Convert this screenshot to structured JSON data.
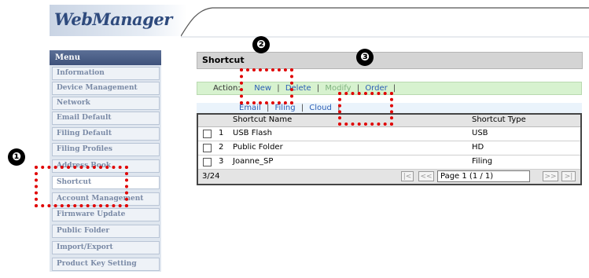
{
  "app": {
    "logo_text": "WebManager"
  },
  "sidebar": {
    "header": "Menu",
    "items": [
      {
        "label": "Information"
      },
      {
        "label": "Device Management"
      },
      {
        "label": "Network"
      },
      {
        "label": "Email Default"
      },
      {
        "label": "Filing Default"
      },
      {
        "label": "Filing Profiles"
      },
      {
        "label": "Address Book"
      },
      {
        "label": "Shortcut",
        "active": true
      },
      {
        "label": "Account Management"
      },
      {
        "label": "Firmware Update"
      },
      {
        "label": "Public Folder"
      },
      {
        "label": "Import/Export"
      },
      {
        "label": "Product Key Setting"
      }
    ]
  },
  "main": {
    "title": "Shortcut",
    "action_label": "Action:",
    "actions": [
      "New",
      "Delete",
      "Modify",
      "Order"
    ],
    "sub_tabs": [
      "Email",
      "Filing",
      "Cloud"
    ],
    "table": {
      "headers": {
        "name": "Shortcut Name",
        "type": "Shortcut Type"
      },
      "rows": [
        {
          "num": "1",
          "name": "USB Flash",
          "type": "USB"
        },
        {
          "num": "2",
          "name": "Public Folder",
          "type": "HD"
        },
        {
          "num": "3",
          "name": "Joanne_SP",
          "type": "Filing"
        }
      ]
    },
    "pager": {
      "count": "3/24",
      "first": "|<",
      "prev": "<<",
      "page": "Page 1 (1 / 1)",
      "next": ">>",
      "last": ">|"
    }
  },
  "annotations": {
    "badges": [
      "❶",
      "❷",
      "❸"
    ],
    "highlight_color": "#e00000"
  }
}
